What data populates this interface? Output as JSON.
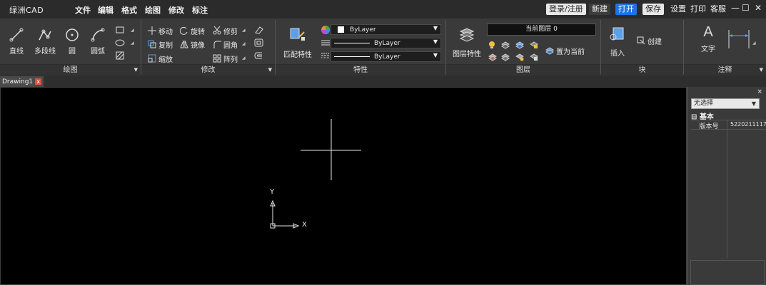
{
  "app": {
    "name": "绿洲CAD"
  },
  "menu": {
    "file": "文件",
    "edit": "编辑",
    "format": "格式",
    "draw": "绘图",
    "modify": "修改",
    "annotate": "标注"
  },
  "titlebar": {
    "login": "登录/注册",
    "new": "新建",
    "open": "打开",
    "save": "保存",
    "settings": "设置",
    "print": "打印",
    "support": "客服",
    "minimize": "—",
    "maximize": "☐",
    "close": "✕"
  },
  "ribbon": {
    "draw": {
      "title": "绘图",
      "line": "直线",
      "polyline": "多段线",
      "circle": "圆",
      "arc": "圆弧"
    },
    "modify": {
      "title": "修改",
      "move": "移动",
      "rotate": "旋转",
      "trim": "修剪",
      "copy": "复制",
      "mirror": "镜像",
      "fillet": "圆角",
      "scale": "缩放",
      "array": "阵列"
    },
    "properties": {
      "title": "特性",
      "match": "匹配特性",
      "color": "ByLayer",
      "linetype": "ByLayer",
      "lineweight": "ByLayer"
    },
    "layers": {
      "title": "图层",
      "layer_props": "图层特性",
      "current_layer": "当前图层 0",
      "set_current": "置为当前"
    },
    "block": {
      "title": "块",
      "insert": "插入",
      "create": "创建"
    },
    "annotation": {
      "title": "注释",
      "text": "文字"
    }
  },
  "tabs": [
    {
      "label": "Drawing1",
      "close": "x"
    }
  ],
  "canvas": {
    "ucs_x": "X",
    "ucs_y": "Y"
  },
  "properties_panel": {
    "close": "×",
    "selection": "无选择",
    "group_toggle": "⊟",
    "group": "基本",
    "rows": [
      {
        "name": "版本号",
        "value": "5220211117"
      }
    ]
  },
  "colors": {
    "ribbon_bg": "#3a3a3a",
    "title_bg": "#2b2b2b",
    "canvas_bg": "#000000",
    "accent_blue": "#1e73e8",
    "tab_close": "#e0503a"
  }
}
